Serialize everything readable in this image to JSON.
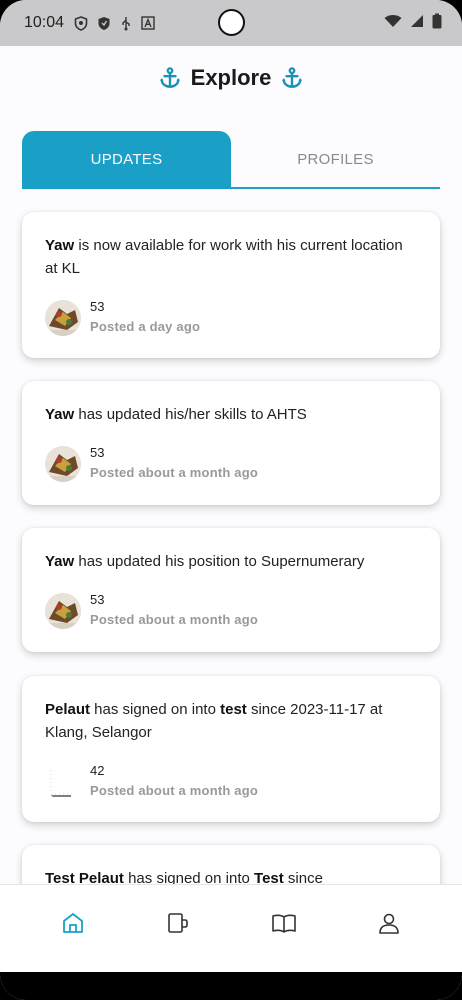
{
  "status_bar": {
    "time": "10:04"
  },
  "header": {
    "title": "Explore"
  },
  "tabs": [
    {
      "label": "UPDATES",
      "active": true
    },
    {
      "label": "PROFILES",
      "active": false
    }
  ],
  "feed": [
    {
      "name": "Yaw",
      "text": " is now available for work with his current location at KL",
      "count": "53",
      "posted": "Posted a day ago",
      "avatar": "photo"
    },
    {
      "name": "Yaw",
      "text": " has updated his/her skills to AHTS",
      "count": "53",
      "posted": "Posted about a month ago",
      "avatar": "photo"
    },
    {
      "name": "Yaw",
      "text": " has updated his position to Supernumerary",
      "count": "53",
      "posted": "Posted about a month ago",
      "avatar": "photo"
    },
    {
      "name": "Pelaut",
      "text_a": " has signed on into ",
      "vessel": "test",
      "text_b": " since 2023-11-17 at Klang, Selangor",
      "count": "42",
      "posted": "Posted about a month ago",
      "avatar": "blank"
    },
    {
      "name": "Test Pelaut",
      "text_a": " has signed on into ",
      "vessel": "Test",
      "text_b": " since"
    }
  ],
  "bottom_nav": [
    {
      "icon": "home-icon",
      "active": true
    },
    {
      "icon": "cup-icon",
      "active": false
    },
    {
      "icon": "book-icon",
      "active": false
    },
    {
      "icon": "person-icon",
      "active": false
    }
  ],
  "colors": {
    "accent": "#1aa0c6",
    "text_muted": "#999999"
  }
}
